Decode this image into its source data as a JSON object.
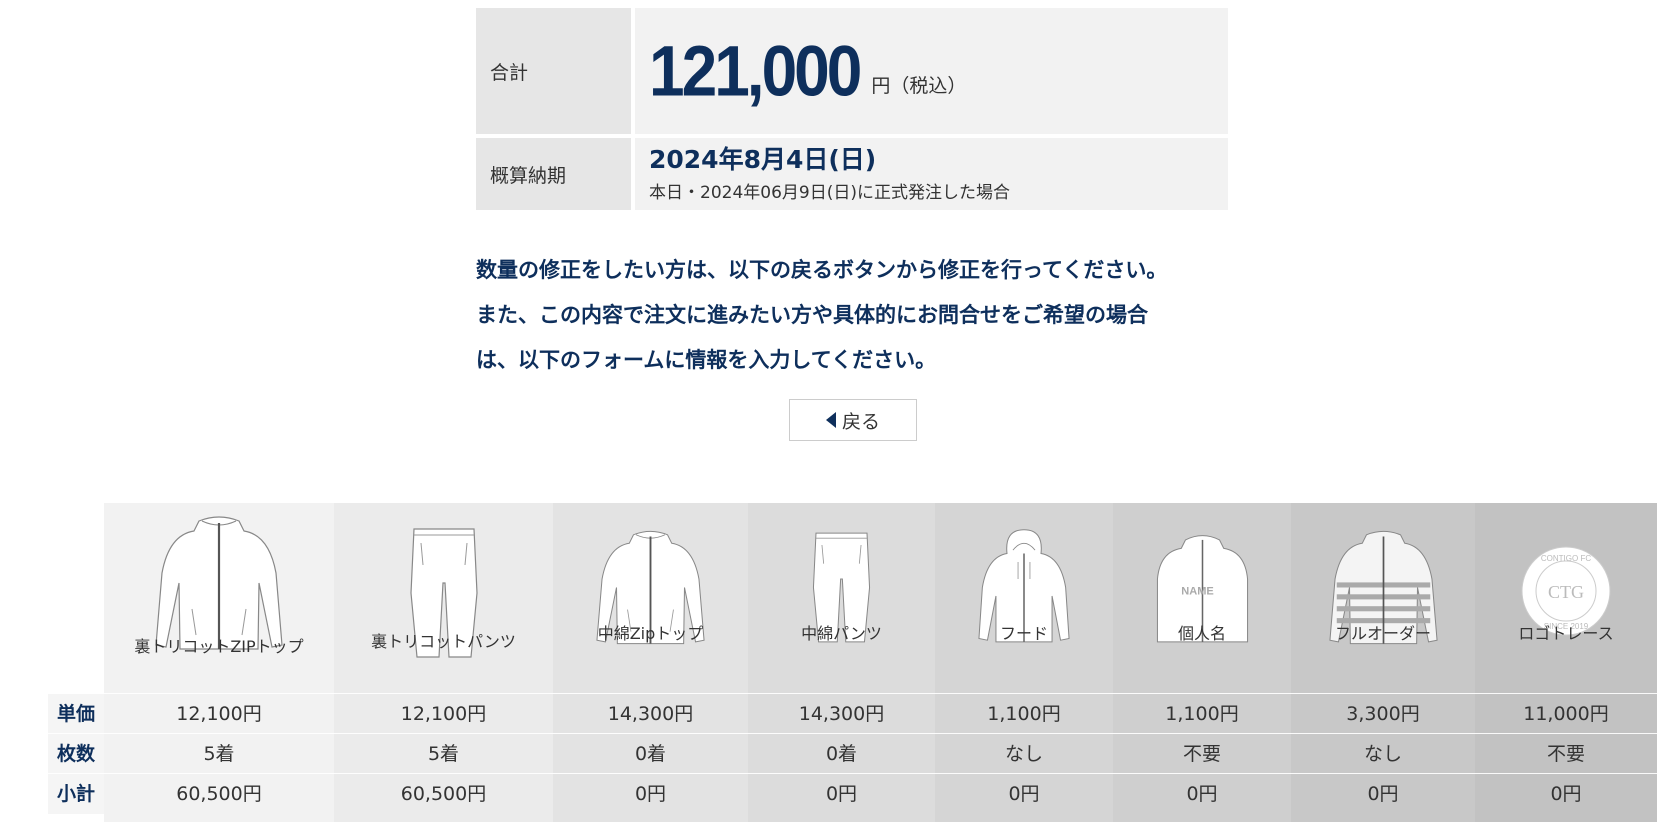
{
  "summary": {
    "total_label": "合計",
    "total_amount": "121,000",
    "total_unit": "円（税込）",
    "delivery_label": "概算納期",
    "delivery_date": "2024年8月4日(日)",
    "delivery_note": "本日・2024年06月9日(日)に正式発注した場合"
  },
  "message": {
    "line1": "数量の修正をしたい方は、以下の戻るボタンから修正を行ってください。",
    "line2": "また、この内容で注文に進みたい方や具体的にお問合せをご希望の場合",
    "line3": "は、以下のフォームに情報を入力してください。"
  },
  "back_button": {
    "label": "戻る",
    "icon": "triangle-left-icon"
  },
  "row_labels": {
    "price": "単価",
    "qty": "枚数",
    "subtotal": "小計"
  },
  "products": [
    {
      "name": "裏トリコットZIPトップ",
      "icon": "zip-jacket-icon",
      "price": "12,100円",
      "qty": "5着",
      "subtotal": "60,500円"
    },
    {
      "name": "裏トリコットパンツ",
      "icon": "pants-icon",
      "price": "12,100円",
      "qty": "5着",
      "subtotal": "60,500円"
    },
    {
      "name": "中綿Zipトップ",
      "icon": "zip-jacket-icon",
      "price": "14,300円",
      "qty": "0着",
      "subtotal": "0円"
    },
    {
      "name": "中綿パンツ",
      "icon": "pants-icon",
      "price": "14,300円",
      "qty": "0着",
      "subtotal": "0円"
    },
    {
      "name": "フード",
      "icon": "hoodie-icon",
      "price": "1,100円",
      "qty": "なし",
      "subtotal": "0円"
    },
    {
      "name": "個人名",
      "icon": "name-print-jacket-icon",
      "price": "1,100円",
      "qty": "不要",
      "subtotal": "0円"
    },
    {
      "name": "フルオーダー",
      "icon": "striped-jacket-icon",
      "price": "3,300円",
      "qty": "なし",
      "subtotal": "0円"
    },
    {
      "name": "ロゴトレース",
      "icon": "logo-emblem-icon",
      "price": "11,000円",
      "qty": "不要",
      "subtotal": "0円",
      "emblem_text": "CONTIGO FC",
      "emblem_center": "CTG",
      "emblem_bottom": "SINCE 2019"
    }
  ],
  "jacket_print_text": "NAME",
  "colors": {
    "accent": "#0e2f5c"
  }
}
